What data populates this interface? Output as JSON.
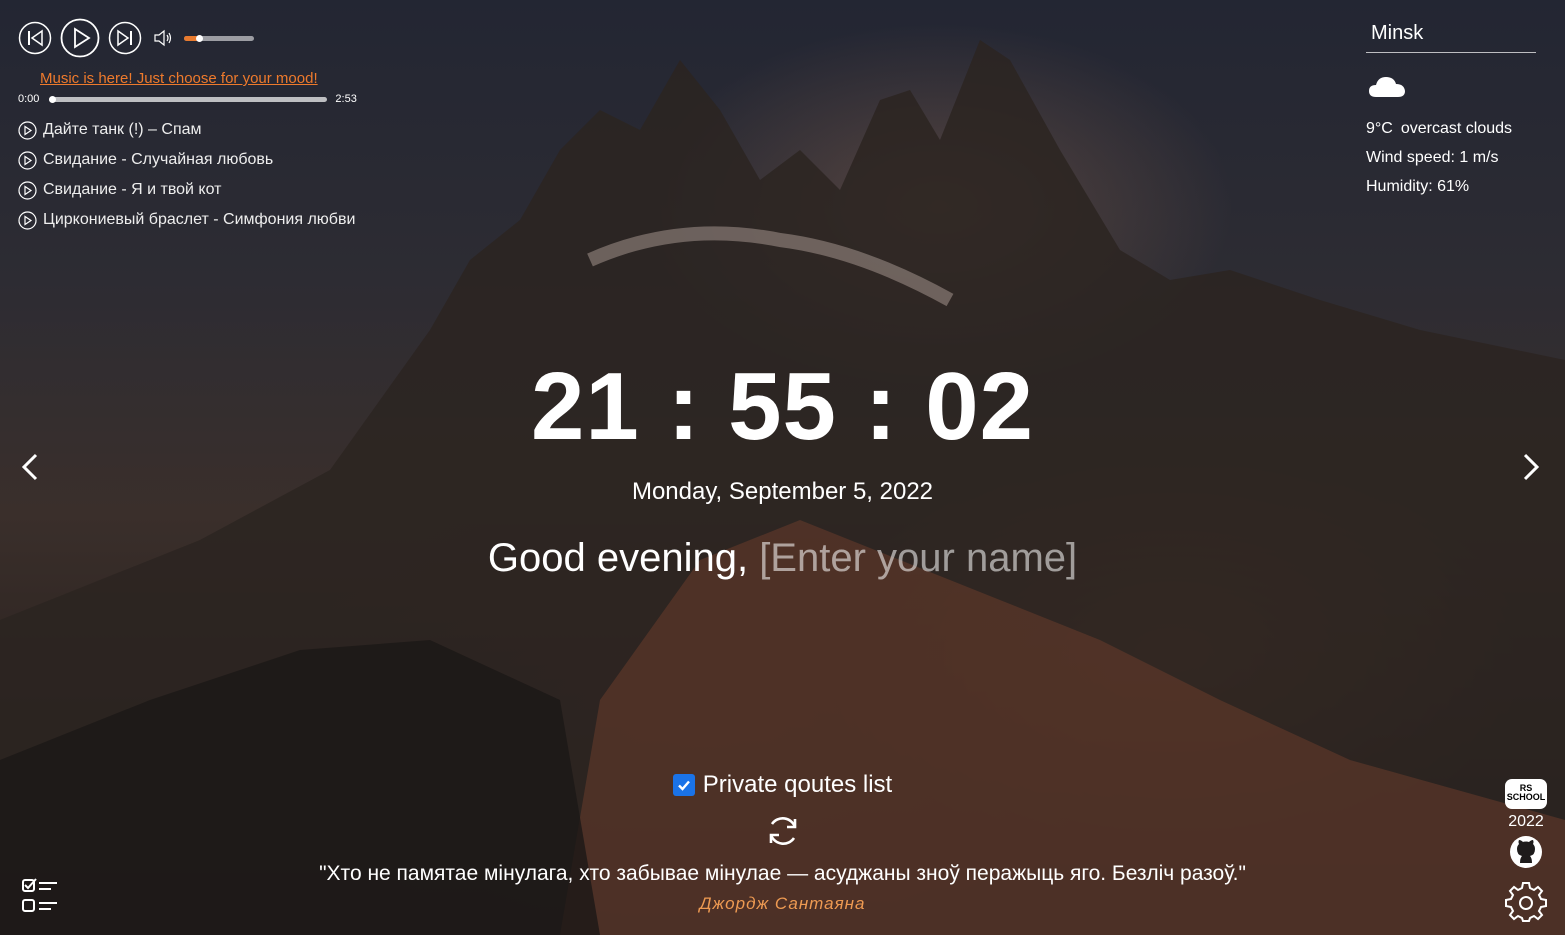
{
  "player": {
    "volume_level": 0.22,
    "mood_link": "Music is here! Just choose for your mood!",
    "current_time": "0:00",
    "duration": "2:53",
    "progress": 0,
    "tracks": [
      "Дайте танк (!) – Спам",
      "Свидание - Случайная любовь",
      "Свидание - Я и твой кот",
      "Циркониевый браслет - Симфония любви"
    ]
  },
  "weather": {
    "city": "Minsk",
    "icon": "cloud-icon",
    "temperature": "9°C",
    "description": "overcast clouds",
    "wind": "Wind speed: 1 m/s",
    "humidity": "Humidity: 61%"
  },
  "clock": {
    "time": "21 : 55 : 02",
    "date": "Monday, September 5, 2022"
  },
  "greeting": {
    "prefix": "Good evening,",
    "name_placeholder": "[Enter your name]"
  },
  "quotes": {
    "private_label": "Private qoutes list",
    "private_checked": true,
    "text": "\"Хто не памятае мінулага, хто забывае мінулае — асуджаны зноў перажыць яго. Безліч разоў.\"",
    "author": "Джордж Сантаяна"
  },
  "footer": {
    "school_logo_text": "RS SCHOOL",
    "year": "2022"
  },
  "colors": {
    "accent": "#ee7a2c",
    "checkbox": "#1a73e8"
  }
}
